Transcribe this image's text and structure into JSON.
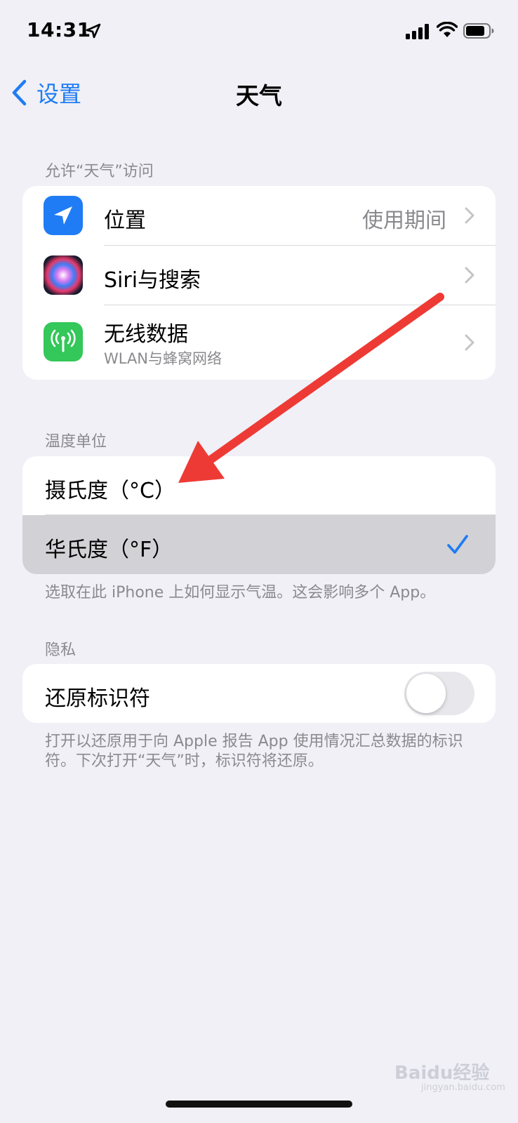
{
  "status_bar": {
    "time": "14:31",
    "icons": [
      "location-arrow-icon",
      "signal-icon",
      "wifi-icon",
      "battery-icon"
    ]
  },
  "nav": {
    "back_label": "设置",
    "title": "天气"
  },
  "access_section": {
    "header": "允许“天气”访问",
    "rows": [
      {
        "label": "位置",
        "value": "使用期间",
        "icon": "location-icon",
        "icon_color": "#1f7cf4"
      },
      {
        "label": "Siri与搜索",
        "icon": "siri-icon"
      },
      {
        "label": "无线数据",
        "sublabel": "WLAN与蜂窝网络",
        "icon": "antenna-icon",
        "icon_color": "#34c759"
      }
    ]
  },
  "temp_section": {
    "header": "温度单位",
    "options": [
      {
        "label": "摄氏度（°C）",
        "selected": false
      },
      {
        "label": "华氏度（°F）",
        "selected": true
      }
    ],
    "footer": "选取在此 iPhone 上如何显示气温。这会影响多个 App。"
  },
  "privacy_section": {
    "header": "隐私",
    "toggle_label": "还原标识符",
    "toggle_on": false,
    "footer": "打开以还原用于向 Apple 报告 App 使用情况汇总数据的标识符。下次打开“天气”时，标识符将还原。"
  },
  "watermark": {
    "text": "Baidu经验",
    "sub": "jingyan.baidu.com"
  },
  "colors": {
    "accent": "#1f7cf4",
    "background": "#f0f0f6",
    "annotation_arrow": "#ee3a35"
  }
}
